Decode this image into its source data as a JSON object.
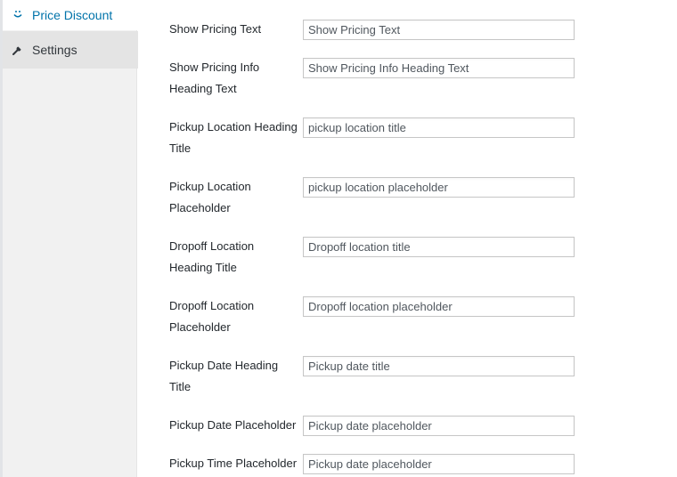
{
  "sidebar": {
    "items": [
      {
        "label": "Price Discount",
        "icon": "smile-icon"
      },
      {
        "label": "Settings",
        "icon": "wrench-icon"
      }
    ]
  },
  "colors": {
    "accent": "#0073aa",
    "sidebar_bg": "#f1f1f1",
    "sidebar_active_bg": "#e4e4e4"
  },
  "form": {
    "rows": [
      {
        "label": "Show Pricing Text",
        "value": "Show Pricing Text"
      },
      {
        "label": "Show Pricing Info Heading Text",
        "value": "Show Pricing Info Heading Text"
      },
      {
        "label": "Pickup Location Heading Title",
        "value": "pickup location title"
      },
      {
        "label": "Pickup Location Placeholder",
        "value": "pickup location placeholder"
      },
      {
        "label": "Dropoff Location Heading Title",
        "value": "Dropoff location title"
      },
      {
        "label": "Dropoff Location Placeholder",
        "value": "Dropoff location placeholder"
      },
      {
        "label": "Pickup Date Heading Title",
        "value": "Pickup date title"
      },
      {
        "label": "Pickup Date Placeholder",
        "value": "Pickup date placeholder"
      },
      {
        "label": "Pickup Time Placeholder",
        "value": "Pickup date placeholder"
      }
    ]
  }
}
